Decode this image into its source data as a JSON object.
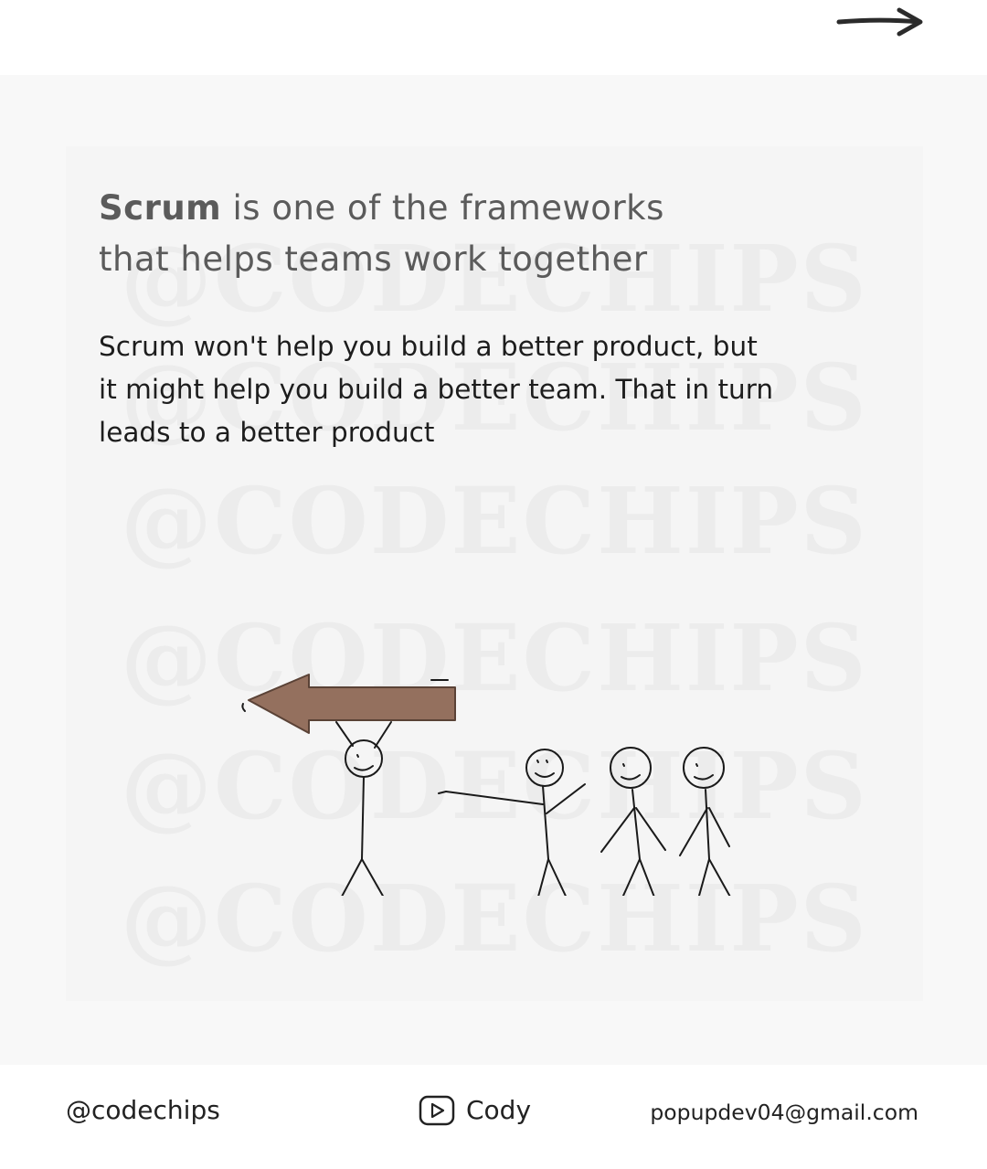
{
  "nav": {
    "next_icon": "arrow-right-icon"
  },
  "watermark": {
    "text": "@CODECHIPS",
    "color": "#ececec"
  },
  "slide": {
    "heading_bold": "Scrum",
    "heading_rest_line1": " is one of the frameworks",
    "heading_line2": "that helps teams work together",
    "body_line1": "Scrum won't help you build a better product,  but",
    "body_line2": "it might help you build a better team. That in turn",
    "body_line3": "leads to a better product"
  },
  "illustration": {
    "description_icon": "stick-figures-carrying-arrow-icon",
    "arrow_color": "#94705e"
  },
  "footer": {
    "handle": "@codechips",
    "channel_icon": "play-button-icon",
    "channel_name": "Cody",
    "email": "popupdev04@gmail.com"
  }
}
